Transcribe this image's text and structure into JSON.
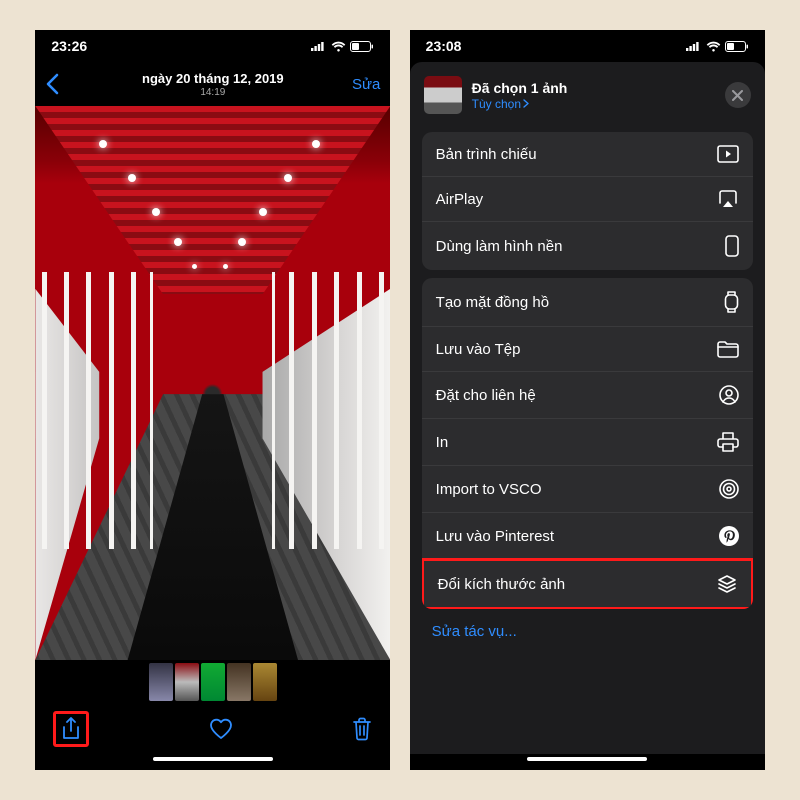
{
  "left": {
    "status": {
      "time": "23:26"
    },
    "nav": {
      "date": "ngày 20 tháng 12, 2019",
      "time": "14:19",
      "edit": "Sửa"
    }
  },
  "right": {
    "status": {
      "time": "23:08"
    },
    "sheet": {
      "selected": "Đã chọn 1 ảnh",
      "options": "Tùy chọn",
      "group1": [
        {
          "label": "Bản trình chiếu",
          "icon": "slideshow"
        },
        {
          "label": "AirPlay",
          "icon": "airplay"
        },
        {
          "label": "Dùng làm hình nền",
          "icon": "phone-frame"
        }
      ],
      "group2": [
        {
          "label": "Tạo mặt đồng hồ",
          "icon": "watch"
        },
        {
          "label": "Lưu vào Tệp",
          "icon": "folder"
        },
        {
          "label": "Đặt cho liên hệ",
          "icon": "contact"
        },
        {
          "label": "In",
          "icon": "print"
        },
        {
          "label": "Import to VSCO",
          "icon": "vsco"
        },
        {
          "label": "Lưu vào Pinterest",
          "icon": "pinterest"
        },
        {
          "label": "Đổi kích thước ảnh",
          "icon": "resize",
          "highlight": true
        }
      ],
      "edit_actions": "Sửa tác vụ..."
    }
  }
}
